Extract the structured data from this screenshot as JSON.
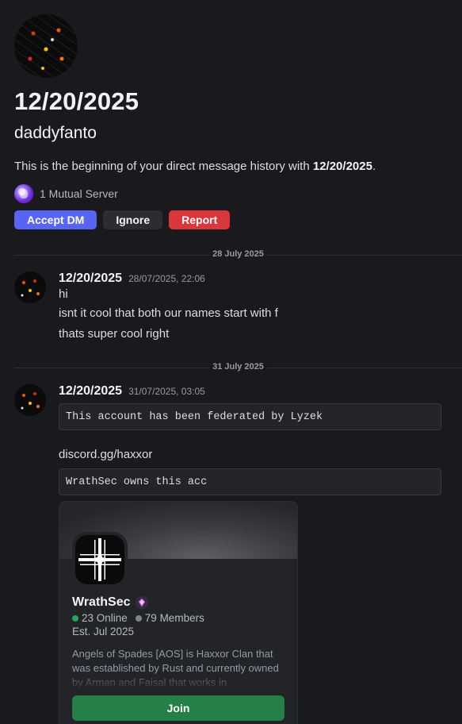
{
  "intro": {
    "title": "12/20/2025",
    "username": "daddyfanto",
    "beginning_prefix": "This is the beginning of your direct message history with ",
    "beginning_name": "12/20/2025",
    "beginning_suffix": ".",
    "mutual_servers": "1 Mutual Server",
    "buttons": {
      "accept": "Accept DM",
      "ignore": "Ignore",
      "report": "Report"
    }
  },
  "dividers": [
    "28 July 2025",
    "31 July 2025"
  ],
  "messages": [
    {
      "author": "12/20/2025",
      "timestamp": "28/07/2025, 22:06",
      "lines": [
        "hi",
        "isnt it cool that both our names start with f",
        "thats super cool right"
      ]
    },
    {
      "author": "12/20/2025",
      "timestamp": "31/07/2025, 03:05",
      "code1": "This account has been federated by Lyzek",
      "link": "discord.gg/haxxor",
      "code2": "WrathSec owns this acc"
    }
  ],
  "invite": {
    "name": "WrathSec",
    "online": "23 Online",
    "members": "79 Members",
    "established": "Est. Jul 2025",
    "description": "Angels of Spades [AOS] is Haxxor Clan that was established by Rust and currently owned by Arman and Faisal that works in",
    "join_label": "Join"
  },
  "colors": {
    "background": "#1a1a1e",
    "accept": "#5865f2",
    "report": "#da373c",
    "join": "#248046",
    "online": "#23a55a"
  },
  "icons": [
    "user-avatar",
    "mutual-server-icon",
    "server-icon",
    "boost-icon"
  ]
}
